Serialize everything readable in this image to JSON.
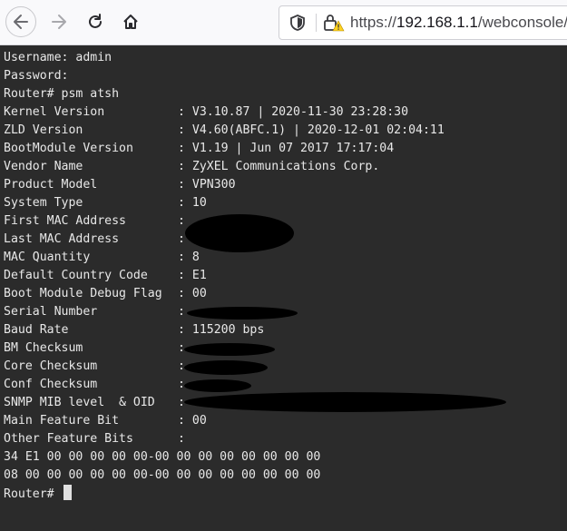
{
  "browser": {
    "url_scheme": "https://",
    "url_host": "192.168.1.1",
    "url_path": "/webconsole/"
  },
  "terminal": {
    "lines_top": [
      "Username: admin",
      "Password:",
      "Router# psm atsh"
    ],
    "fields": [
      {
        "label": "Kernel Version",
        "value": ": V3.10.87 | 2020-11-30 23:28:30"
      },
      {
        "label": "ZLD Version",
        "value": ": V4.60(ABFC.1) | 2020-12-01 02:04:11"
      },
      {
        "label": "BootModule Version",
        "value": ": V1.19 | Jun 07 2017 17:17:04"
      },
      {
        "label": "Vendor Name",
        "value": ": ZyXEL Communications Corp."
      },
      {
        "label": "Product Model",
        "value": ": VPN300"
      },
      {
        "label": "System Type",
        "value": ": 10"
      },
      {
        "label": "First MAC Address",
        "value": ":"
      },
      {
        "label": "Last MAC Address",
        "value": ":"
      },
      {
        "label": "MAC Quantity",
        "value": ": 8"
      },
      {
        "label": "Default Country Code",
        "value": ": E1"
      },
      {
        "label": "Boot Module Debug Flag",
        "value": ": 00"
      },
      {
        "label": "Serial Number",
        "value": ":"
      },
      {
        "label": "Baud Rate",
        "value": ": 115200 bps"
      },
      {
        "label": "BM Checksum",
        "value": ":"
      },
      {
        "label": "Core Checksum",
        "value": ":"
      },
      {
        "label": "Conf Checksum",
        "value": ":"
      },
      {
        "label": "SNMP MIB level  & OID",
        "value": ":"
      },
      {
        "label": "Main Feature Bit",
        "value": ": 00"
      },
      {
        "label": "Other Feature Bits",
        "value": ":"
      }
    ],
    "lines_bottom": [
      "34 E1 00 00 00 00 00-00 00 00 00 00 00 00 00",
      "08 00 00 00 00 00 00-00 00 00 00 00 00 00 00"
    ],
    "prompt": "Router# "
  }
}
